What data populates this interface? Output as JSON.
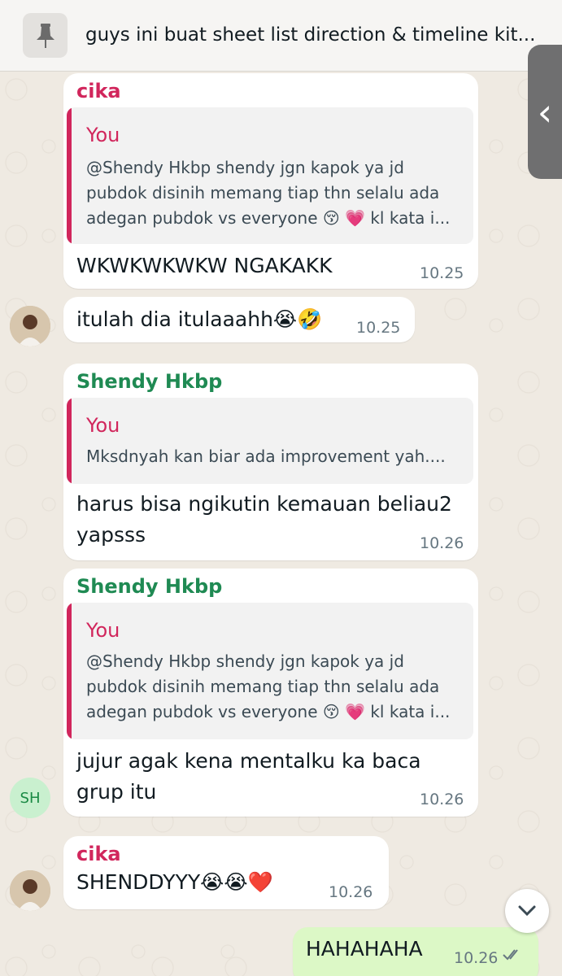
{
  "pinned": {
    "text": "guys ini buat sheet list direction & timeline kit..."
  },
  "colors": {
    "background": "#efeae2",
    "incoming_bubble": "#ffffff",
    "outgoing_bubble": "#dcf8c6",
    "cika_name": "#d1265c",
    "shendy_name": "#1f8a53",
    "quote_accent": "#d1265c"
  },
  "messages": [
    {
      "sender": "cika",
      "quote": {
        "author": "You",
        "lines": [
          "@Shendy Hkbp shendy jgn kapok ya jd",
          "pubdok disinih memang tiap thn selalu ada",
          "adegan pubdok vs everyone 😚 💗 kl kata i..."
        ]
      },
      "text": "WKWKWKWKW NGAKAKK",
      "time": "10.25"
    },
    {
      "text": "itulah dia itulaaahh😭🤣",
      "time": "10.25"
    },
    {
      "sender": "Shendy Hkbp",
      "quote": {
        "author": "You",
        "lines": [
          "Mksdnyah kan biar ada improvement yah...."
        ]
      },
      "text_lines": [
        "harus bisa ngikutin kemauan beliau2",
        "yapsss"
      ],
      "time": "10.26"
    },
    {
      "sender": "Shendy Hkbp",
      "quote": {
        "author": "You",
        "lines": [
          "@Shendy Hkbp shendy jgn kapok ya jd",
          "pubdok disinih memang tiap thn selalu ada",
          "adegan pubdok vs everyone 😚 💗 kl kata i..."
        ]
      },
      "text_lines": [
        "jujur agak kena mentalku ka baca",
        "grup itu"
      ],
      "time": "10.26",
      "avatar_initials": "SH"
    },
    {
      "sender": "cika",
      "text": "SHENDDYYY😭😭❤️",
      "time": "10.26"
    },
    {
      "text": "HAHAHAHA",
      "time": "10.26",
      "outgoing": true
    }
  ],
  "icons": {
    "pin": "pin-icon",
    "side_tab": "chevron-left-icon",
    "scroll_down": "chevron-down-icon",
    "read_receipt": "double-check-icon"
  }
}
